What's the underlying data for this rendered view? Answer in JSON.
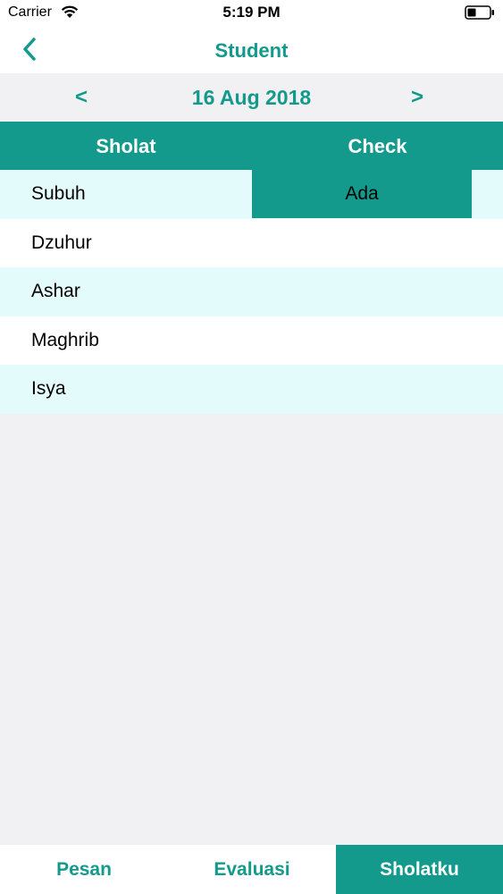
{
  "status_bar": {
    "carrier": "Carrier",
    "time": "5:19 PM",
    "wifi_icon": "wifi-icon",
    "battery_icon": "battery-icon"
  },
  "nav": {
    "back_icon": "chevron-left-icon",
    "title": "Student"
  },
  "date_bar": {
    "prev": "<",
    "date": "16 Aug 2018",
    "next": ">"
  },
  "table": {
    "headers": [
      "Sholat",
      "Check"
    ],
    "rows": [
      {
        "name": "Subuh",
        "check": "Ada"
      },
      {
        "name": "Dzuhur",
        "check": ""
      },
      {
        "name": "Ashar",
        "check": ""
      },
      {
        "name": "Maghrib",
        "check": ""
      },
      {
        "name": "Isya",
        "check": ""
      }
    ]
  },
  "tabs": [
    {
      "label": "Pesan",
      "active": false
    },
    {
      "label": "Evaluasi",
      "active": false
    },
    {
      "label": "Sholatku",
      "active": true
    }
  ],
  "colors": {
    "accent": "#139a8c",
    "row_alt": "#e4fbfc",
    "background": "#f1f0f2"
  }
}
